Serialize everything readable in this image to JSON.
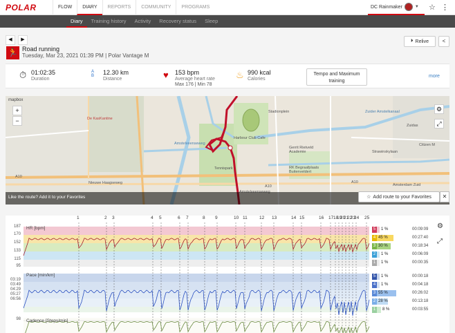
{
  "nav": {
    "logo": "POLAR",
    "links": [
      "FLOW",
      "DIARY",
      "REPORTS",
      "COMMUNITY",
      "PROGRAMS"
    ],
    "user": "DC Rainmaker"
  },
  "subnav": [
    "Diary",
    "Training history",
    "Activity",
    "Recovery status",
    "Sleep"
  ],
  "session": {
    "sport": "Road running",
    "datetime": "Tuesday, Mar 23, 2021 01:39 PM | Polar Vantage M",
    "relive_label": "Relive"
  },
  "stats": {
    "duration_value": "01:02:35",
    "duration_label": "Duration",
    "distance_value": "12.30 km",
    "distance_label": "Distance",
    "distance_ab": "A  B",
    "hr_value": "153 bpm",
    "hr_label": "Average heart rate",
    "hr_minmax": "Max 176  |  Min 78",
    "cal_value": "990 kcal",
    "cal_label": "Calories",
    "benefit": "Tempo and Maximum training",
    "more": "more"
  },
  "map": {
    "provider": "mapbox",
    "like_route": "Like the route?",
    "add_favorites_link": "Add it to your Favorites",
    "add_route_button": "Add route to your Favorites",
    "labels": {
      "l1": "De KasKantine",
      "l2": "Nieuwe Haagseweg",
      "l3": "Harbour Club Cafe",
      "l4": "Gerrit Rietveld Academie",
      "l5": "RK Begraafplaats Buitenveldert",
      "l6": "Tennispark",
      "l7": "Zuider Amstelkanaal",
      "l8": "Stadionplein",
      "l9": "Amstelveenseweg",
      "l10": "Amsterdam Zuid",
      "l11": "Strawinskylaan",
      "l12": "Citizen M",
      "l13": "A10",
      "l14": "A10",
      "l15": "A10",
      "l16": "Amstelveenseweg",
      "l17": "Zuidas"
    }
  },
  "charts": {
    "laps": [
      "1",
      "2",
      "3",
      "4",
      "5",
      "6",
      "7",
      "8",
      "9",
      "10",
      "11",
      "12",
      "13",
      "14",
      "15",
      "16",
      "17",
      "18",
      "19",
      "20",
      "21",
      "22",
      "23",
      "24",
      "25"
    ],
    "hr": {
      "title": "HR [bpm]",
      "ticks": [
        "187",
        "170",
        "152",
        "133",
        "115",
        "95"
      ],
      "zones": [
        {
          "n": "5",
          "pct": "1 %",
          "time": "00:09:09",
          "color": "#d03a5a"
        },
        {
          "n": "4",
          "pct": "45 %",
          "time": "00:27:40",
          "color": "#e8b800"
        },
        {
          "n": "3",
          "pct": "30 %",
          "time": "00:18:34",
          "color": "#7ab648"
        },
        {
          "n": "2",
          "pct": "1 %",
          "time": "00:06:09",
          "color": "#3aa0d8"
        },
        {
          "n": "1",
          "pct": "1 %",
          "time": "00:00:35",
          "color": "#aaaaaa"
        }
      ]
    },
    "pace": {
      "title": "Pace [min/km]",
      "ticks": [
        "03:19",
        "03:49",
        "04:29",
        "05:27",
        "06:56"
      ],
      "zones": [
        {
          "n": "5",
          "pct": "1 %",
          "time": "00:00:18",
          "color": "#3355aa"
        },
        {
          "n": "4",
          "pct": "1 %",
          "time": "00:04:18",
          "color": "#4a70c8"
        },
        {
          "n": "3",
          "pct": "55 %",
          "time": "00:26:02",
          "color": "#5a8ad8"
        },
        {
          "n": "2",
          "pct": "28 %",
          "time": "00:13:18",
          "color": "#7aaee8"
        },
        {
          "n": "1",
          "pct": "8 %",
          "time": "00:03:55",
          "color": "#9ad0a0"
        }
      ]
    },
    "cadence": {
      "title": "Cadence [Steps/min]",
      "ticks": [
        "98"
      ]
    }
  }
}
